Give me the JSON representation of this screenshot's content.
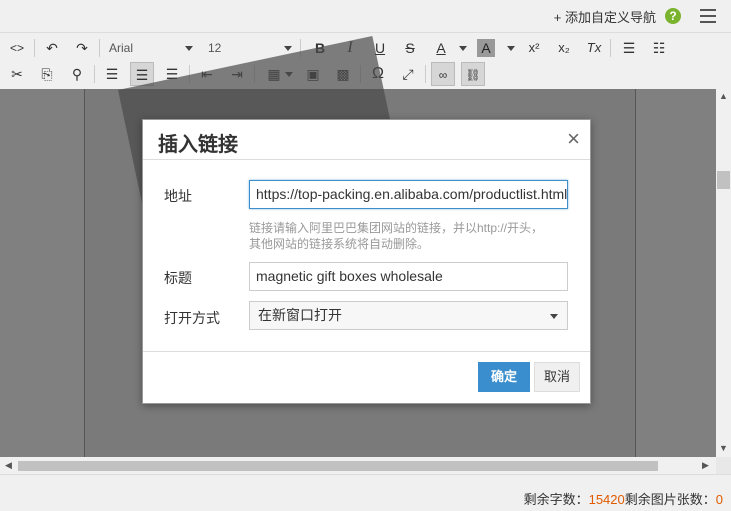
{
  "topbar": {
    "add_nav_label": "+ 添加自定义导航",
    "help_label": "?"
  },
  "toolbar": {
    "font_family": "Arial",
    "font_size": "12",
    "row1": [
      {
        "name": "source-code-button",
        "glyph": "<>"
      },
      {
        "name": "undo-button",
        "glyph": "↶"
      },
      {
        "name": "redo-button",
        "glyph": "↷"
      },
      {
        "name": "bold-button",
        "glyph": "B"
      },
      {
        "name": "italic-button",
        "glyph": "I"
      },
      {
        "name": "underline-button",
        "glyph": "U"
      },
      {
        "name": "strikethrough-button",
        "glyph": "S"
      },
      {
        "name": "font-color-button",
        "glyph": "A"
      },
      {
        "name": "background-color-button",
        "glyph": "A"
      },
      {
        "name": "superscript-button",
        "glyph": "x²"
      },
      {
        "name": "subscript-button",
        "glyph": "x₂"
      },
      {
        "name": "clear-format-button",
        "glyph": "Tx"
      },
      {
        "name": "bullet-list-button",
        "glyph": "≡"
      },
      {
        "name": "numbered-list-button",
        "glyph": "≡"
      }
    ],
    "row2": [
      {
        "name": "cut-button",
        "glyph": "✂"
      },
      {
        "name": "copy-button",
        "glyph": "⎘"
      },
      {
        "name": "find-button",
        "glyph": "⚲"
      },
      {
        "name": "align-left-button",
        "glyph": "≡"
      },
      {
        "name": "align-center-button",
        "glyph": "≡"
      },
      {
        "name": "align-right-button",
        "glyph": "≡"
      },
      {
        "name": "outdent-button",
        "glyph": "⇤"
      },
      {
        "name": "indent-button",
        "glyph": "⇥"
      },
      {
        "name": "table-button",
        "glyph": "▦"
      },
      {
        "name": "insert-image-button",
        "glyph": "▣"
      },
      {
        "name": "insert-grid-button",
        "glyph": "▩"
      },
      {
        "name": "special-char-button",
        "glyph": "Ω"
      },
      {
        "name": "fullscreen-button",
        "glyph": "⤢"
      },
      {
        "name": "link-button",
        "glyph": "🔗"
      },
      {
        "name": "unlink-button",
        "glyph": "⛓"
      }
    ]
  },
  "dialog": {
    "title": "插入链接",
    "close_label": "×",
    "address_label": "地址",
    "address_value": "https://top-packing.en.alibaba.com/productlist.html",
    "hint_line1": "链接请输入阿里巴巴集团网站的链接，并以http://开头，",
    "hint_line2": "其他网站的链接系统将自动删除。",
    "title_label": "标题",
    "title_value": "magnetic gift boxes wholesale",
    "open_mode_label": "打开方式",
    "open_mode_value": "在新窗口打开",
    "ok_label": "确定",
    "cancel_label": "取消"
  },
  "status": {
    "remaining_chars_label": "剩余字数：",
    "remaining_chars_value": "15420",
    "remaining_images_label": "剩余图片张数：",
    "remaining_images_value": "0"
  }
}
